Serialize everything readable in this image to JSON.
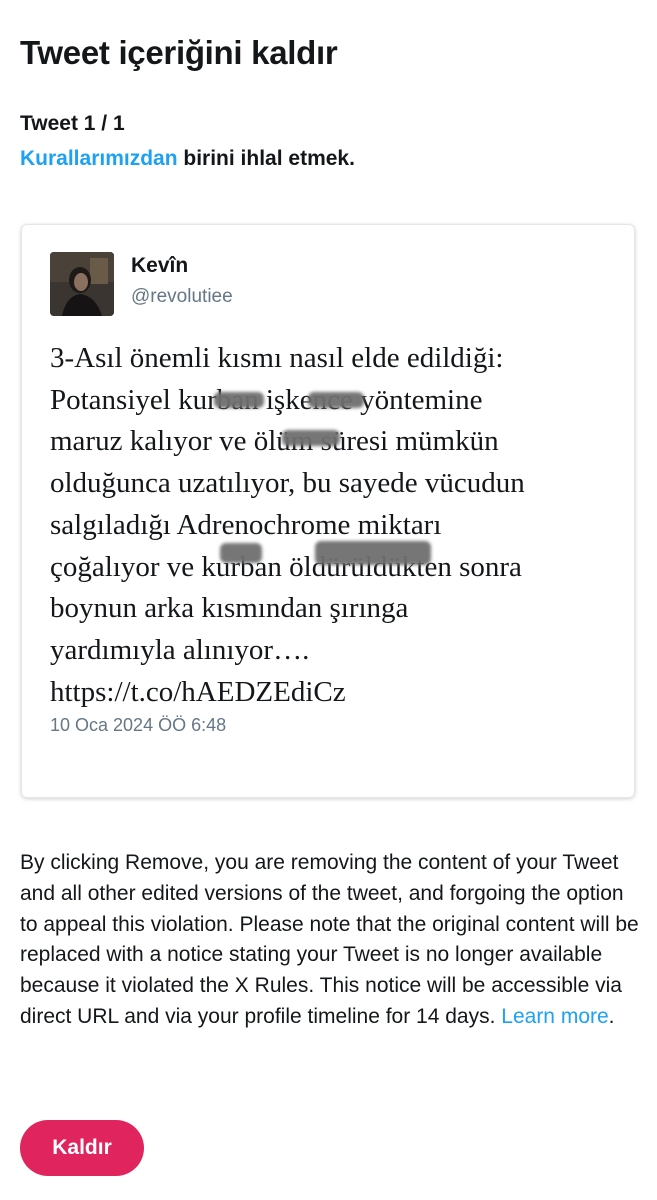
{
  "page": {
    "title": "Tweet içeriğini kaldır",
    "counter": "Tweet 1 / 1",
    "rule_link": "Kurallarımızdan",
    "rule_rest": " birini ihlal etmek."
  },
  "tweet": {
    "author_name": "Kevîn",
    "author_handle": "@revolutiee",
    "text": "3-Asıl önemli kısmı nasıl elde edildiği:\nPotansiyel kurban işkence yöntemine\nmaruz kalıyor ve ölüm süresi mümkün\nolduğunca uzatılıyor, bu sayede vücudun\nsalgıladığı Adrenochrome miktarı\nçoğalıyor ve kurban öldürüldükten sonra\nboynun arka kısmından şırınga\nyardımıyla alınıyor….\nhttps://t.co/hAEDZEdiCz",
    "date": "10 Oca 2024 ÖÖ 6:48"
  },
  "notice": {
    "text": "By clicking Remove, you are removing the content of your Tweet and all other edited versions of the tweet, and forgoing the option to appeal this violation. Please note that the original content will be replaced with a notice stating your Tweet is no longer available because it violated the X Rules. This notice will be accessible via direct URL and via your profile timeline for 14 days. ",
    "link": "Learn more",
    "end": "."
  },
  "actions": {
    "remove_label": "Kaldır"
  },
  "colors": {
    "link": "#1da1f2",
    "remove_button": "#e0245e",
    "secondary_text": "#657786"
  }
}
